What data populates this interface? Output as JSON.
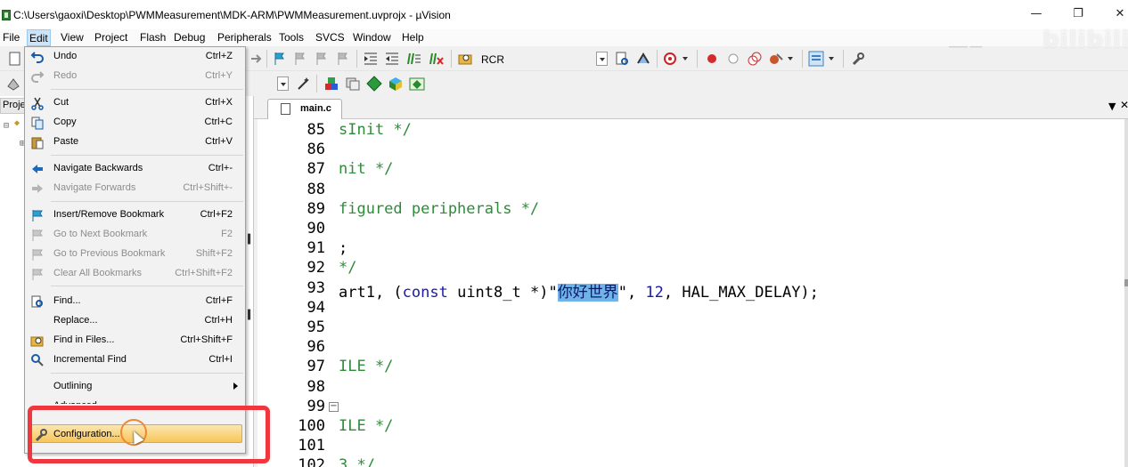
{
  "window": {
    "title": "C:\\Users\\gaoxi\\Desktop\\PWMMeasurement\\MDK-ARM\\PWMMeasurement.uvprojx - µVision",
    "minimize": "—",
    "maximize": "❐",
    "close": "✕"
  },
  "menubar": [
    "File",
    "Edit",
    "View",
    "Project",
    "Flash",
    "Debug",
    "Peripherals",
    "Tools",
    "SVCS",
    "Window",
    "Help"
  ],
  "toolbar": {
    "target_label": "RCR"
  },
  "left_panel": {
    "tab_label": "Project"
  },
  "editor": {
    "tab_label": "main.c",
    "lines": [
      {
        "num": "85",
        "text": "sInit */"
      },
      {
        "num": "86",
        "text": ""
      },
      {
        "num": "87",
        "text": "nit */"
      },
      {
        "num": "88",
        "text": ""
      },
      {
        "num": "89",
        "text": "figured peripherals */"
      },
      {
        "num": "90",
        "text": ""
      },
      {
        "num": "91",
        "text": ";"
      },
      {
        "num": "92",
        "text": "*/"
      },
      {
        "num": "93",
        "text": "art1, (const uint8_t *)\"你好世界\", 12, HAL_MAX_DELAY);"
      },
      {
        "num": "94",
        "text": ""
      },
      {
        "num": "95",
        "text": ""
      },
      {
        "num": "96",
        "text": ""
      },
      {
        "num": "97",
        "text": "ILE */"
      },
      {
        "num": "98",
        "text": ""
      },
      {
        "num": "99",
        "text": ""
      },
      {
        "num": "100",
        "text": "ILE */"
      },
      {
        "num": "101",
        "text": ""
      },
      {
        "num": "102",
        "text": "3 */"
      }
    ],
    "line93": {
      "prefix": "art1, (",
      "keyword": "const",
      "mid": " uint8_t *)",
      "quote_open": "\"",
      "selected": "你好世界",
      "quote_close": "\"",
      "comma1": ", ",
      "num": "12",
      "suffix": ", HAL_MAX_DELAY);"
    }
  },
  "edit_menu": {
    "items": [
      {
        "label": "Undo",
        "shortcut": "Ctrl+Z",
        "enabled": true,
        "icon": "undo-icon"
      },
      {
        "label": "Redo",
        "shortcut": "Ctrl+Y",
        "enabled": false,
        "icon": "redo-icon"
      },
      {
        "label": "Cut",
        "shortcut": "Ctrl+X",
        "enabled": true,
        "icon": "cut-icon"
      },
      {
        "label": "Copy",
        "shortcut": "Ctrl+C",
        "enabled": true,
        "icon": "copy-icon"
      },
      {
        "label": "Paste",
        "shortcut": "Ctrl+V",
        "enabled": true,
        "icon": "paste-icon"
      },
      {
        "label": "Navigate Backwards",
        "shortcut": "Ctrl+-",
        "enabled": true,
        "icon": "arrow-left-icon"
      },
      {
        "label": "Navigate Forwards",
        "shortcut": "Ctrl+Shift+-",
        "enabled": false,
        "icon": "arrow-right-icon"
      },
      {
        "label": "Insert/Remove Bookmark",
        "shortcut": "Ctrl+F2",
        "enabled": true,
        "icon": "bookmark-icon"
      },
      {
        "label": "Go to Next Bookmark",
        "shortcut": "F2",
        "enabled": false,
        "icon": "next-bookmark-icon"
      },
      {
        "label": "Go to Previous Bookmark",
        "shortcut": "Shift+F2",
        "enabled": false,
        "icon": "previous-bookmark-icon"
      },
      {
        "label": "Clear All Bookmarks",
        "shortcut": "Ctrl+Shift+F2",
        "enabled": false,
        "icon": "clear-bookmarks-icon"
      },
      {
        "label": "Find...",
        "shortcut": "Ctrl+F",
        "enabled": true,
        "icon": "find-icon"
      },
      {
        "label": "Replace...",
        "shortcut": "Ctrl+H",
        "enabled": true,
        "icon": ""
      },
      {
        "label": "Find in Files...",
        "shortcut": "Ctrl+Shift+F",
        "enabled": true,
        "icon": "find-in-files-icon"
      },
      {
        "label": "Incremental Find",
        "shortcut": "Ctrl+I",
        "enabled": true,
        "icon": "incremental-find-icon"
      },
      {
        "label": "Outlining",
        "shortcut": "",
        "enabled": true,
        "icon": ""
      },
      {
        "label": "Advanced",
        "shortcut": "",
        "enabled": true,
        "icon": ""
      },
      {
        "label": "Configuration...",
        "shortcut": "",
        "enabled": true,
        "icon": "wrench-icon"
      }
    ]
  },
  "watermark": {
    "brand": "bilibili"
  }
}
